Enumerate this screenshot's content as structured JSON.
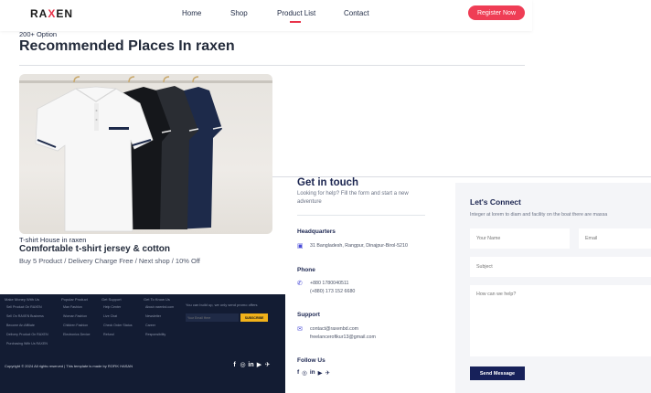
{
  "header": {
    "logo_pre": "RA",
    "logo_x": "X",
    "logo_post": "EN",
    "nav": [
      "Home",
      "Shop",
      "Product List",
      "Contact"
    ],
    "register": "Register Now",
    "accent": "#ef3d55"
  },
  "recommended": {
    "eyebrow": "200+ Option",
    "title": "Recommended Places In raxen"
  },
  "product": {
    "category": "T-shirt House in raxen",
    "title": "Comfortable t-shirt jersey & cotton",
    "info": "Buy 5 Product / Delivery Charge Free / Next shop / 10% Off"
  },
  "footer": {
    "columns": [
      {
        "title": "Make Money With Us",
        "items": [
          "Sell Product On RAXEN",
          "Sell On RAXEN Business",
          "Become An Affiliate",
          "Delivery Product On RAXEN",
          "Purchasing With Us RAXEN"
        ]
      },
      {
        "title": "Popular Product",
        "items": [
          "Man Fashion",
          "Woman Fashion",
          "Children Fashion",
          "Electronics Device"
        ]
      },
      {
        "title": "Get Support",
        "items": [
          "Help Center",
          "Live Chat",
          "Check Order Status",
          "Refund"
        ]
      },
      {
        "title": "Get To Know Us",
        "items": [
          "About raxenbd.com",
          "Newsletter",
          "Career",
          "Responsibility"
        ]
      }
    ],
    "subscribe_text": "You can build up, we only send promo offers",
    "email_placeholder": "Your Email Here",
    "subscribe_button": "SUBSCRIBE",
    "copyright": "Copyright © 2024 All rights reserved | This template is made by ROFIK HASAN",
    "accent": "#f2b21a"
  },
  "touch": {
    "title": "Get in touch",
    "subtitle": "Looking for help? Fill the form and start a new adventure",
    "headquarters_label": "Headquarters",
    "address": "31 Bangladesh, Rangpur, Dinajpur-Birol-5210",
    "phone_label": "Phone",
    "phone1": "+880 1780040511",
    "phone2": "(+880) 173 152 6680",
    "support_label": "Support",
    "email1": "contact@raxenbd.com",
    "email2": "freelancerofikur13@gmail.com",
    "follow_label": "Follow Us",
    "icon_color": "#4b4dd8"
  },
  "connect": {
    "title": "Let's Connect",
    "subtitle": "Integer at lorem to diam and facility on the boat there are massa",
    "name_placeholder": "Your Name",
    "email_placeholder": "Email",
    "subject_placeholder": "Subject",
    "message_placeholder": "How can we help?",
    "send": "Send Message"
  }
}
